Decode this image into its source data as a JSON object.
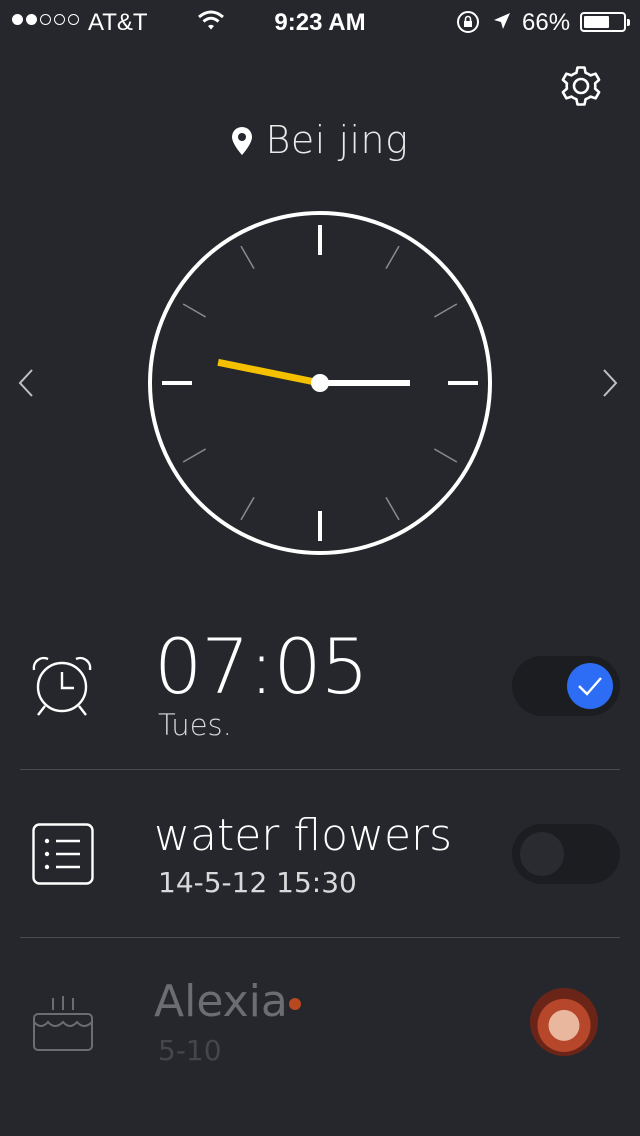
{
  "status_bar": {
    "carrier": "AT&T",
    "signal_bars_filled": 2,
    "signal_bars_total": 5,
    "time": "9:23 AM",
    "battery_percent": "66%",
    "battery_level": 0.66
  },
  "header": {
    "settings_icon": "gear-icon",
    "location_icon": "map-pin-icon",
    "city": "Bei jing"
  },
  "clock": {
    "hour": 9,
    "minute": 23,
    "hour_hand_color": "#f5c000",
    "hand_color": "#ffffff",
    "nav_prev_icon": "chevron-left-icon",
    "nav_next_icon": "chevron-right-icon"
  },
  "alarm": {
    "icon": "alarm-clock-icon",
    "time": "07:05",
    "day": "Tues.",
    "enabled": true,
    "accent_color": "#2d6cf4"
  },
  "task": {
    "icon": "list-icon",
    "title": "water flowers",
    "datetime": "14-5-12 15:30",
    "enabled": false
  },
  "birthday": {
    "icon": "cake-icon",
    "name": "Alexia",
    "date": "5-10",
    "dot_color": "#b8481f"
  }
}
